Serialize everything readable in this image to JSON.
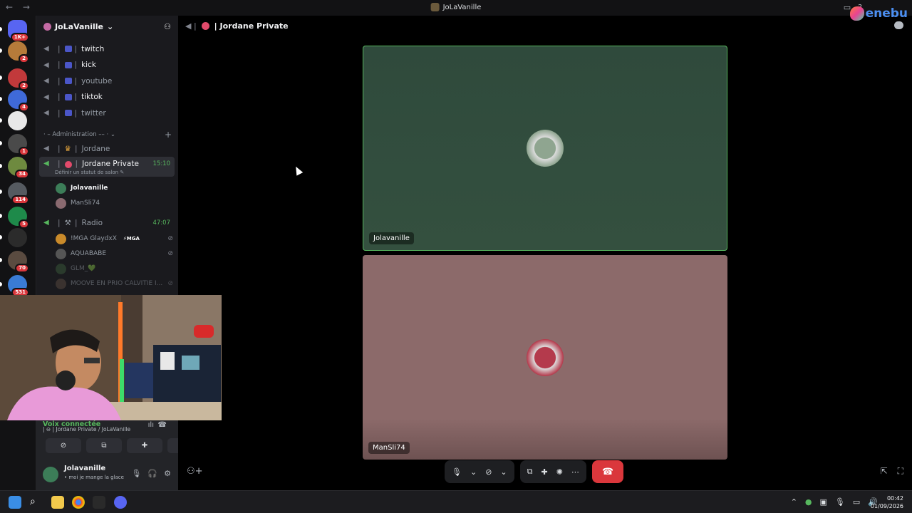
{
  "window": {
    "title": "JoLaVanille",
    "nav_back": "←",
    "nav_fwd": "→"
  },
  "brand": {
    "logo_text": "enebu"
  },
  "guilds": [
    {
      "name": "discord-home",
      "badge": "1K+",
      "color": "#5865f2"
    },
    {
      "name": "guild-1",
      "badge": "2",
      "color": "#b67b3a"
    },
    {
      "name": "guild-2",
      "badge": "2",
      "color": "#c2393b"
    },
    {
      "name": "guild-3",
      "badge": "4",
      "color": "#3f6ad8"
    },
    {
      "name": "guild-4",
      "badge": "",
      "color": "#e8e8e8"
    },
    {
      "name": "guild-5",
      "badge": "1",
      "color": "#4a4a4a"
    },
    {
      "name": "guild-6",
      "badge": "34",
      "color": "#6e8a3f"
    },
    {
      "name": "guild-7",
      "badge": "114",
      "color": "#555a60"
    },
    {
      "name": "guild-8",
      "badge": "5",
      "color": "#1e8a4a"
    },
    {
      "name": "guild-9",
      "badge": "",
      "color": "#2b2b2b"
    },
    {
      "name": "guild-10",
      "badge": "70",
      "color": "#5a4b40"
    },
    {
      "name": "guild-11",
      "badge": "531",
      "color": "#3a7bd5"
    }
  ],
  "server": {
    "name": "JoLaVanille",
    "chevron": "⌄"
  },
  "channels": [
    {
      "label": "twitch",
      "bright": true
    },
    {
      "label": "kick",
      "bright": true
    },
    {
      "label": "youtube",
      "bright": false
    },
    {
      "label": "tiktok",
      "bright": true
    },
    {
      "label": "twitter",
      "bright": false
    }
  ],
  "category": {
    "label": "Administration",
    "plus": "+"
  },
  "admin_channels": {
    "jordane": "Jordane",
    "private": {
      "label": "Jordane Private",
      "time": "15:10",
      "sub": "Définir un statut de salon ✎"
    },
    "radio": {
      "label": "Radio",
      "time": "47:07"
    }
  },
  "private_members": [
    {
      "name": "Jolavanille",
      "bright": true,
      "color": "#3c7d58"
    },
    {
      "name": "ManSli74",
      "bright": false,
      "color": "#8a6a70"
    }
  ],
  "radio_members": [
    {
      "name": "!MGA GlaydxX",
      "tag": "⚡MGA",
      "color": "#c98a2a"
    },
    {
      "name": "AQUABABE",
      "tag": "",
      "color": "#555"
    },
    {
      "name": "GLM_💚",
      "tag": "",
      "color": "#3a5a3a"
    },
    {
      "name": "MOOVE EN PRIO CALVITIE I...",
      "tag": "",
      "color": "#5a4b40"
    }
  ],
  "voice": {
    "status": "Voix connectée",
    "channel": "| ⊖ | Jordane Private / JoLaVanille"
  },
  "user": {
    "name": "Jolavanille",
    "status": "• moi je mange la glace"
  },
  "call": {
    "header": "| Jordane Private",
    "participants": [
      {
        "name": "Jolavanille",
        "bg": "#2f4a3c",
        "avatar_color": "#8fa590"
      },
      {
        "name": "ManSli74",
        "bg": "#8c6a6a",
        "avatar_color": "#b43a4c"
      }
    ]
  },
  "clock": {
    "time": "00:42",
    "date": "01/09/2026"
  }
}
